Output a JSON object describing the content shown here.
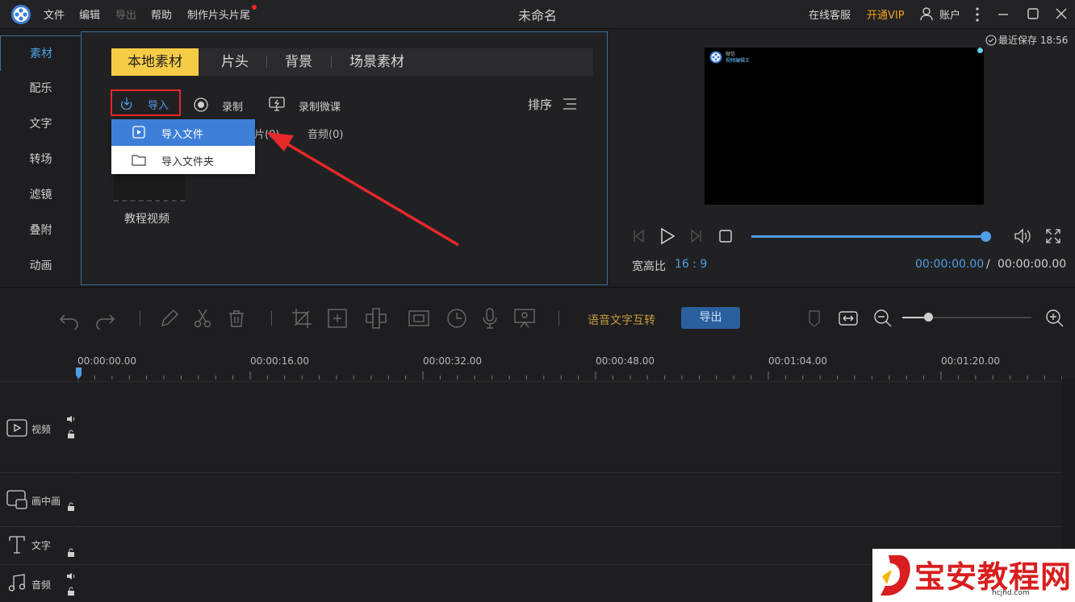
{
  "titlebar": {
    "menu": [
      "文件",
      "编辑",
      "导出",
      "帮助",
      "制作片头片尾"
    ],
    "title": "未命名",
    "online_service": "在线客服",
    "vip": "开通VIP",
    "account": "账户"
  },
  "left_tabs": [
    "素材",
    "配乐",
    "文字",
    "转场",
    "滤镜",
    "叠附",
    "动画"
  ],
  "material": {
    "subtabs": [
      "本地素材",
      "片头",
      "背景",
      "场景素材"
    ],
    "actions": {
      "import": "导入",
      "record": "录制",
      "record_lesson": "录制微课",
      "sort": "排序"
    },
    "filters": {
      "image": "片(0)",
      "audio": "音频(0)"
    },
    "dropdown": [
      "导入文件",
      "导入文件夹"
    ],
    "thumbnail_caption": "教程视频"
  },
  "preview": {
    "last_saved": "最近保存 18:56",
    "aspect_label": "宽高比",
    "aspect_value": "16 : 9",
    "time_current": "00:00:00.00",
    "time_sep": "/",
    "time_total": "00:00:00.00",
    "progress": 1.0,
    "overlay_line1": "微信",
    "overlay_line2": "视频编辑王"
  },
  "toolbar": {
    "speech_text": "语音文字互转",
    "export": "导出",
    "zoom_level": 0.2
  },
  "timeline": {
    "ticks": [
      "00:00:00.00",
      "00:00:16.00",
      "00:00:32.00",
      "00:00:48.00",
      "00:01:04.00",
      "00:01:20.00"
    ],
    "tracks": [
      "视频",
      "画中画",
      "文字",
      "音频"
    ]
  },
  "watermark": {
    "name": "宝安教程网",
    "url": "hcjhd.com"
  },
  "colors": {
    "accent_blue": "#4f9fe8",
    "highlight_yellow": "#f6cc47",
    "vip_orange": "#f0a020",
    "annotation_red": "#e8282a",
    "export_button": "#2c5f9e"
  }
}
